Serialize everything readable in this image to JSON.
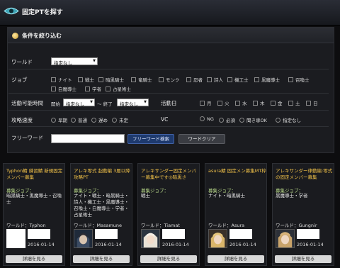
{
  "header": {
    "title": "固定PTを探す"
  },
  "filter": {
    "title": "条件を絞り込む",
    "world": {
      "label": "ワールド",
      "value": "指定なし"
    },
    "job": {
      "label": "ジョブ",
      "options": [
        "ナイト",
        "戦士",
        "暗黒騎士",
        "竜騎士",
        "モンク",
        "忍者",
        "詩人",
        "機工士",
        "黒魔導士",
        "召喚士",
        "白魔導士",
        "学者",
        "占星術士"
      ]
    },
    "time": {
      "label": "活動可能時間",
      "start_label": "開始",
      "start_value": "指定なし",
      "sep": "～ 終了",
      "end_value": "指定なし"
    },
    "days": {
      "label": "活動日",
      "options": [
        "月",
        "火",
        "水",
        "木",
        "金",
        "土",
        "日"
      ]
    },
    "speed": {
      "label": "攻略速度",
      "options": [
        "早期",
        "普通",
        "遅め",
        "未定"
      ]
    },
    "vc": {
      "label": "VC",
      "options": [
        "NG",
        "必須",
        "聞き専OK",
        "指定なし"
      ]
    },
    "freeword": {
      "label": "フリーワード",
      "value": "",
      "search_label": "フリーワード検索",
      "clear_label": "ワードクリア"
    }
  },
  "cards": [
    {
      "title": "Typhon鯖 練習鯖 新規固定メンバー募集",
      "jobs_label": "募集ジョブ：",
      "jobs": "暗黒騎士・黒魔導士・召喚士",
      "world": "ワールド：Typhon",
      "date": "2016-01-14",
      "detail": "詳細を見る"
    },
    {
      "title": "アレキ零式 起動編 3層以降攻略PT",
      "jobs_label": "募集ジョブ：",
      "jobs": "ナイト・戦士・暗黒騎士・詩人・機工士・黒魔導士・召喚士・白魔導士・学者・占星術士",
      "world": "ワールド：Masamune",
      "date": "2016-01-14",
      "detail": "詳細を見る"
    },
    {
      "title": "アレキサンダー固定メンバー募集中です◎暗黒さ",
      "jobs_label": "募集ジョブ：",
      "jobs": "戦士",
      "world": "ワールド：Tiamat",
      "date": "2016-01-14",
      "detail": "詳細を見る"
    },
    {
      "title": "asura鯖 固定メン募集MT枠",
      "jobs_label": "募集ジョブ：",
      "jobs": "ナイト・暗黒騎士",
      "world": "ワールド：Asura",
      "date": "2016-01-14",
      "detail": "詳細を見る"
    },
    {
      "title": "アレキサンダー律動編:零式の固定メンバー募集",
      "jobs_label": "募集ジョブ：",
      "jobs": "黒魔導士・学者",
      "world": "ワールド：Gungnir",
      "date": "2016-01-14",
      "detail": "詳細を見る"
    }
  ]
}
